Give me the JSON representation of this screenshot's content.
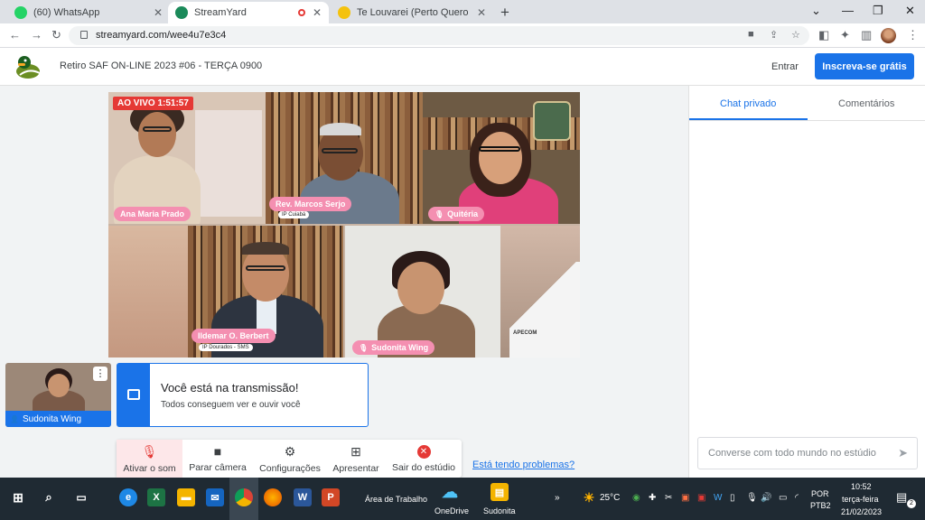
{
  "browser": {
    "tabs": [
      {
        "title": "(60) WhatsApp",
        "icon": "whatsapp-icon",
        "color": "#25d366"
      },
      {
        "title": "StreamYard",
        "icon": "streamyard-icon",
        "color": "#1b8a5a"
      },
      {
        "title": "Te Louvarei (Perto Quero Estar) -",
        "icon": "smiley-icon",
        "color": "#f4c20d"
      }
    ],
    "url": "streamyard.com/wee4u7e3c4"
  },
  "header": {
    "title": "Retiro SAF ON-LINE 2023 #06 - TERÇA 0900",
    "login_label": "Entrar",
    "signup_label": "Inscreva-se grátis",
    "accent": "#1a73e8"
  },
  "stage": {
    "live_label": "AO VIVO 1:51:57",
    "participants": [
      {
        "name": "Ana Maria Prado",
        "subtitle": ""
      },
      {
        "name": "Rev. Marcos Serjo",
        "subtitle": "IP Cuiabá"
      },
      {
        "name": "Quitéria",
        "subtitle": ""
      },
      {
        "name": "Ildemar O. Berbert",
        "subtitle": "IP Dourados - SMS"
      },
      {
        "name": "Sudonita Wing",
        "subtitle": ""
      }
    ],
    "logo_text": "APECOM"
  },
  "self_preview": {
    "name": "Sudonita Wing"
  },
  "notice": {
    "title": "Você está na transmissão!",
    "subtitle": "Todos conseguem ver e ouvir você"
  },
  "controls": {
    "mute_label": "Ativar o som",
    "camera_label": "Parar câmera",
    "settings_label": "Configurações",
    "present_label": "Apresentar",
    "leave_label": "Sair do estúdio",
    "problems_label": "Está tendo problemas?"
  },
  "chat": {
    "tab_private": "Chat privado",
    "tab_comments": "Comentários",
    "input_placeholder": "Converse com todo mundo no estúdio"
  },
  "taskbar": {
    "desktop_label": "Área de Trabalho",
    "onedrive_label": "OneDrive",
    "sudonita_label": "Sudonita",
    "temperature": "25°C",
    "lang_top": "POR",
    "lang_bottom": "PTB2",
    "time": "10:52",
    "weekday": "terça-feira",
    "date": "21/02/2023",
    "notifications": "2"
  }
}
